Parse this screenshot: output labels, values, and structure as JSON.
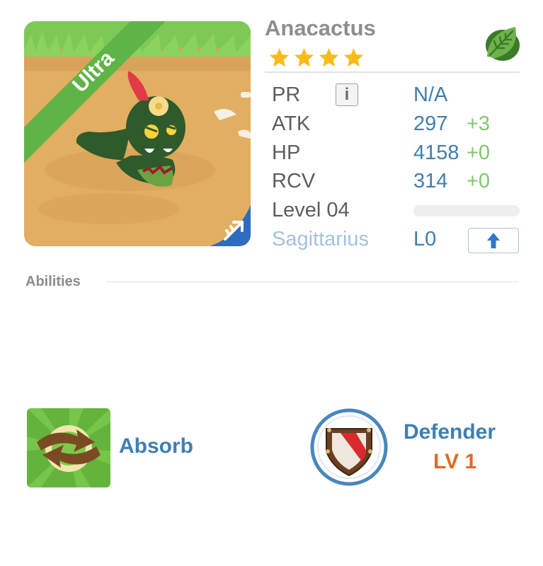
{
  "monster": {
    "name": "Anacactus",
    "rarity": "Ultra",
    "stars": 4,
    "element_icon": "leaf-icon",
    "zodiac_icon": "sagittarius-arrow-icon"
  },
  "stats": {
    "pr": {
      "label": "PR",
      "value": "N/A"
    },
    "atk": {
      "label": "ATK",
      "value": "297",
      "bonus": "+3"
    },
    "hp": {
      "label": "HP",
      "value": "4158",
      "bonus": "+0"
    },
    "rcv": {
      "label": "RCV",
      "value": "314",
      "bonus": "+0"
    },
    "level": {
      "label": "Level 04",
      "progress": 0
    },
    "zodiac": {
      "label": "Sagittarius",
      "value": "L0"
    }
  },
  "abilities": {
    "header": "Abilities",
    "items": [
      {
        "name": "Absorb",
        "icon": "absorb-arrows-icon"
      },
      {
        "name": "Defender",
        "level": "LV 1",
        "icon": "shield-icon"
      }
    ]
  },
  "colors": {
    "accent_blue": "#3f7fb0",
    "bonus_green": "#7ec86a",
    "level_orange": "#e06a26",
    "rarity_green": "#5fb447"
  }
}
